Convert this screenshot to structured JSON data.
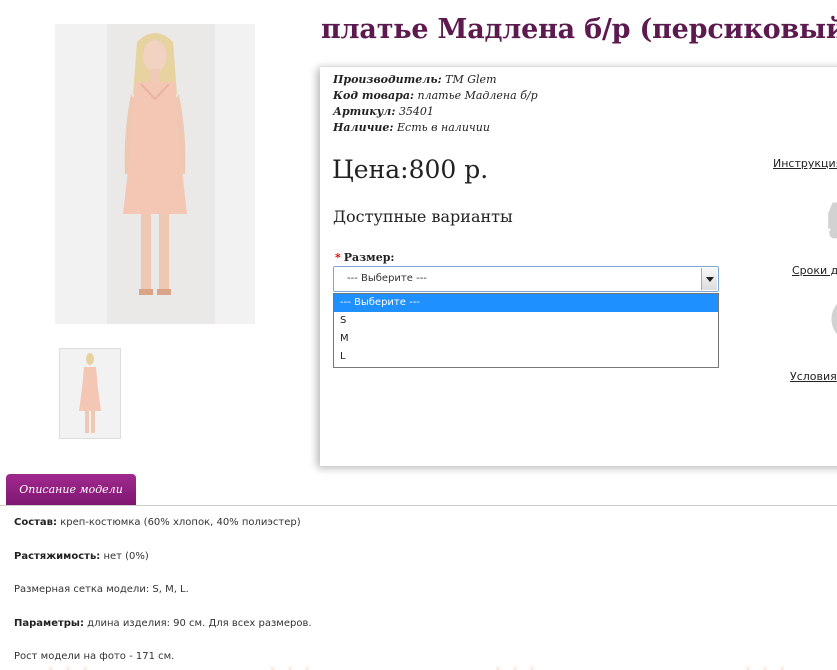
{
  "product": {
    "title": "платье Мадлена б/р (персиковый)",
    "meta": [
      {
        "key": "Производитель:",
        "value": "ТМ Glem"
      },
      {
        "key": "Код товара:",
        "value": "платье Мадлена б/р"
      },
      {
        "key": "Артикул:",
        "value": "35401"
      },
      {
        "key": "Наличие:",
        "value": "Есть в наличии"
      }
    ],
    "price": "Цена:800 р.",
    "variants_title": "Доступные варианты"
  },
  "size_select": {
    "label": "Размер:",
    "required_mark": "*",
    "selected": "--- Выберите ---",
    "options": [
      "--- Выберите ---",
      "S",
      "M",
      "L"
    ]
  },
  "side_links": {
    "instruction": "Инструкция",
    "delivery": "Сроки до",
    "conditions": "Условия"
  },
  "tabs": {
    "description": "Описание модели"
  },
  "description": [
    {
      "key": "Состав:",
      "value": " креп-костюмка (60% хлопок, 40% полиэстер)"
    },
    {
      "key": "Растяжимость:",
      "value": " нет (0%)"
    },
    {
      "key": "",
      "value": "Размерная сетка модели: S, M, L."
    },
    {
      "key": "Параметры:",
      "value": " длина изделия: 90 см. Для всех размеров."
    },
    {
      "key": "",
      "value": "Рост модели на фото - 171 см."
    }
  ],
  "colors": {
    "title": "#5c1a4f",
    "tab": "#8e1f7f",
    "dress": "#f4c6b4",
    "select_highlight": "#1e90ff"
  }
}
